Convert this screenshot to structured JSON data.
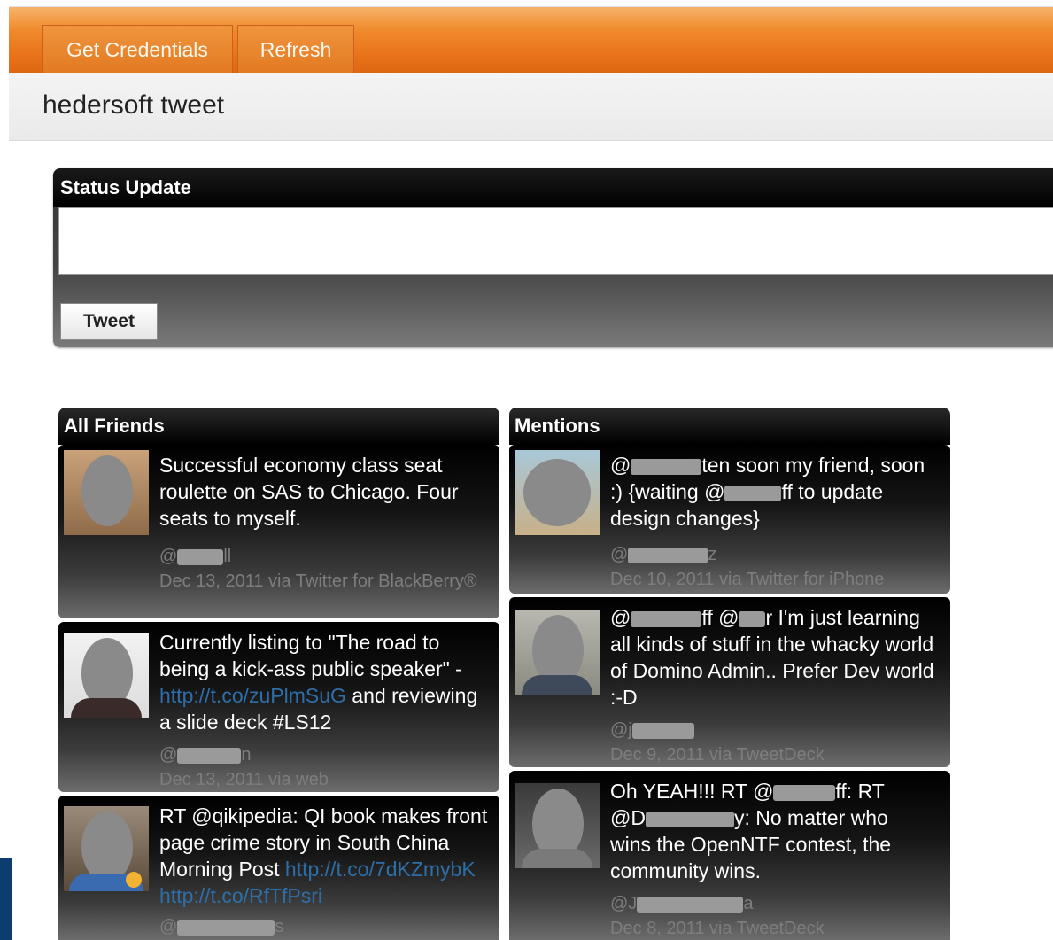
{
  "toolbar": {
    "tabs": [
      {
        "label": "Get Credentials"
      },
      {
        "label": "Refresh"
      }
    ]
  },
  "page": {
    "title": "hedersoft tweet"
  },
  "status": {
    "header": "Status Update",
    "textarea_value": "",
    "button": "Tweet"
  },
  "friends": {
    "header": "All Friends",
    "items": [
      {
        "text": "Successful economy class seat roulette on SAS to Chicago. Four seats to myself.",
        "user_prefix": "@",
        "user_suffix": "ll",
        "meta": "Dec 13, 2011 via Twitter for BlackBerry®"
      },
      {
        "text_before": "Currently listing to \"The road to being a kick-ass public speaker\" - ",
        "link": "http://t.co/zuPlmSuG",
        "text_after": " and reviewing a slide deck #LS12",
        "user_prefix": "@",
        "user_suffix": "n",
        "meta": "Dec 13, 2011 via web"
      },
      {
        "text_before": "RT @qikipedia: QI book makes front page crime story in South China Morning Post ",
        "link": "http://t.co/7dKZmybK http://t.co/RfTfPsri",
        "user_prefix": "@",
        "user_suffix": "s"
      }
    ]
  },
  "mentions": {
    "header": "Mentions",
    "items": [
      {
        "line1_a": "@",
        "line1_b": "ten soon my friend, soon",
        "line2_a": ":) {waiting @",
        "line2_b": "ff to update",
        "line3": "design changes}",
        "user_prefix": "@",
        "user_suffix": "z",
        "meta": "Dec 10, 2011 via Twitter for iPhone"
      },
      {
        "line1_a": "@",
        "line1_b": "ff @",
        "line1_c": "r I'm just learning",
        "rest": "all kinds of stuff in the whacky world of Domino Admin.. Prefer Dev world :-D",
        "user_prefix": "@j",
        "meta": "Dec 9, 2011 via TweetDeck"
      },
      {
        "line1_a": "Oh YEAH!!! RT @",
        "line1_b": "ff: RT",
        "line2_a": "@D",
        "line2_b": "y: No matter who",
        "rest": "wins the OpenNTF contest, the community wins.",
        "user_prefix": "@J",
        "user_suffix": "a",
        "meta": "Dec 8, 2011 via TweetDeck"
      }
    ]
  }
}
